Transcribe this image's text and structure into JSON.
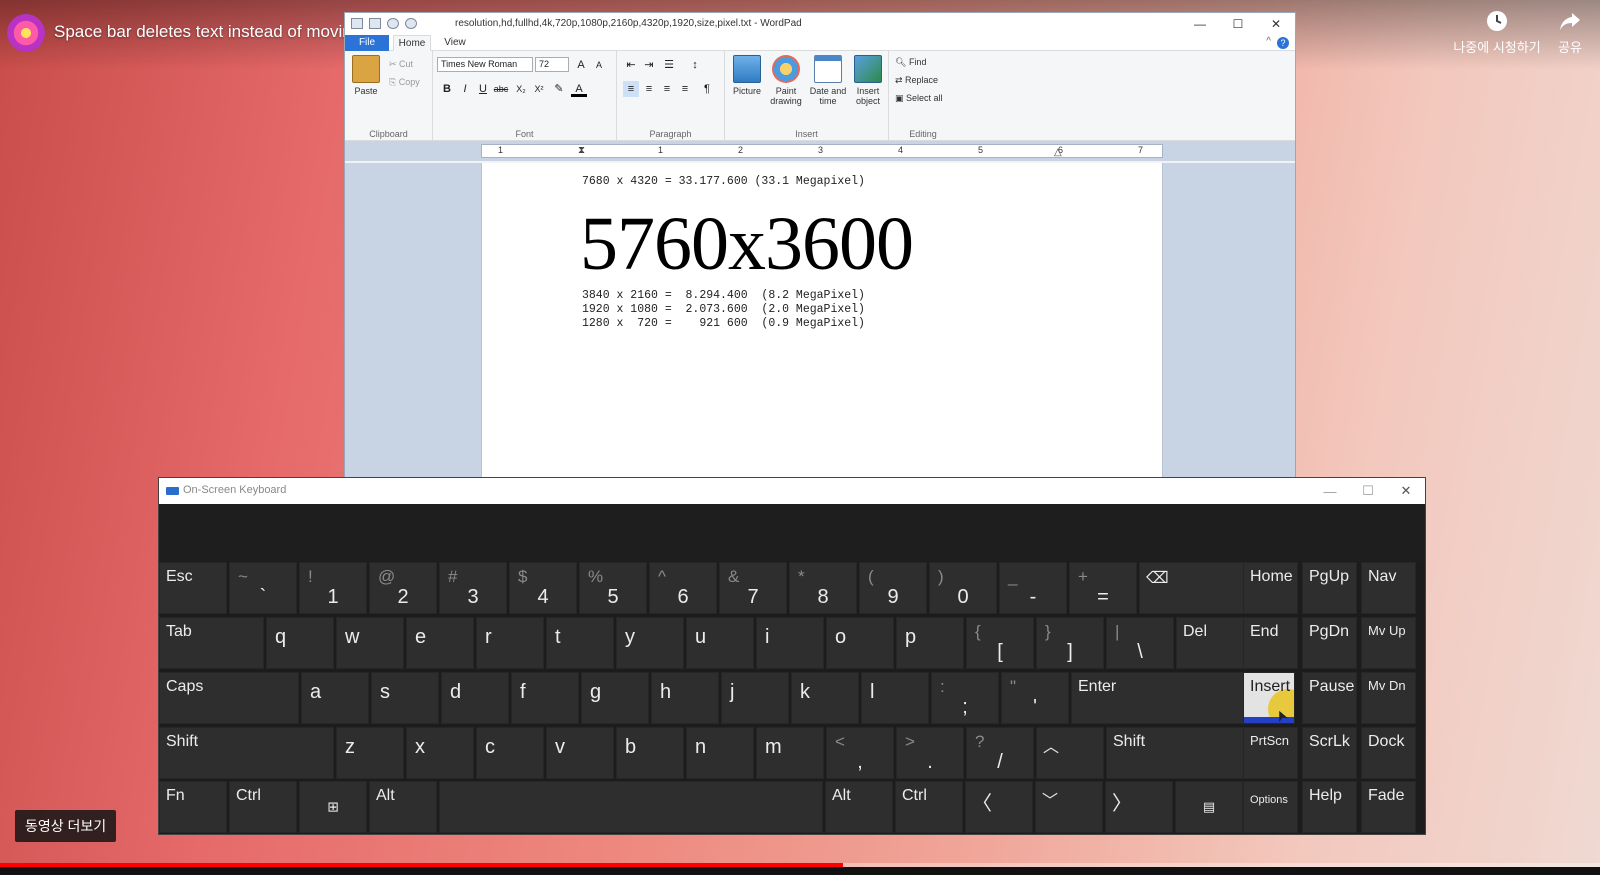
{
  "youtube": {
    "video_title": "Space bar deletes text instead of moving it - Solution",
    "watch_later": "나중에 시청하기",
    "share": "공유",
    "more_videos": "동영상 더보기",
    "progress": 0.527
  },
  "wordpad": {
    "title": "resolution,hd,fullhd,4k,720p,1080p,2160p,4320p,1920,size,pixel.txt - WordPad",
    "tabs": {
      "file": "File",
      "home": "Home",
      "view": "View"
    },
    "clipboard": {
      "paste": "Paste",
      "cut": "Cut",
      "copy": "Copy",
      "label": "Clipboard"
    },
    "font": {
      "name": "Times New Roman",
      "size": "72",
      "label": "Font",
      "bold": "B",
      "italic": "I",
      "underline": "U",
      "strike": "abc",
      "sub": "X₂",
      "sup": "X²"
    },
    "paragraph": {
      "label": "Paragraph"
    },
    "insert": {
      "picture": "Picture",
      "paint_drawing": "Paint drawing",
      "date_time": "Date and time",
      "insert_object": "Insert object",
      "label": "Insert"
    },
    "editing": {
      "find": "Find",
      "replace": "Replace",
      "select_all": "Select all",
      "label": "Editing"
    },
    "ruler_numbers": [
      "1",
      "1",
      "2",
      "3",
      "4",
      "5",
      "6",
      "7"
    ],
    "doc": {
      "line_top": "7680 x 4320 = 33.177.600 (33.1 Megapixel)",
      "big": "5760x3600",
      "lines": [
        "3840 x 2160 =  8.294.400  (8.2 MegaPixel)",
        "1920 x 1080 =  2.073.600  (2.0 MegaPixel)",
        "1280 x  720 =    921 600  (0.9 MegaPixel)"
      ]
    }
  },
  "osk": {
    "title": "On-Screen Keyboard",
    "keys": {
      "esc": "Esc",
      "tab": "Tab",
      "caps": "Caps",
      "shift_l": "Shift",
      "shift_r": "Shift",
      "fn": "Fn",
      "ctrl_l": "Ctrl",
      "alt_l": "Alt",
      "alt_r": "Alt",
      "ctrl_r": "Ctrl",
      "del": "Del",
      "enter": "Enter",
      "home": "Home",
      "pgup": "PgUp",
      "nav": "Nav",
      "end": "End",
      "pgdn": "PgDn",
      "mvup": "Mv Up",
      "insert": "Insert",
      "pause": "Pause",
      "mvdn": "Mv Dn",
      "prtscn": "PrtScn",
      "scrlk": "ScrLk",
      "dock": "Dock",
      "options": "Options",
      "help": "Help",
      "fade": "Fade"
    },
    "number_row": [
      {
        "s": "~",
        "m": "`"
      },
      {
        "s": "!",
        "m": "1"
      },
      {
        "s": "@",
        "m": "2"
      },
      {
        "s": "#",
        "m": "3"
      },
      {
        "s": "$",
        "m": "4"
      },
      {
        "s": "%",
        "m": "5"
      },
      {
        "s": "^",
        "m": "6"
      },
      {
        "s": "&",
        "m": "7"
      },
      {
        "s": "*",
        "m": "8"
      },
      {
        "s": "(",
        "m": "9"
      },
      {
        "s": ")",
        "m": "0"
      },
      {
        "s": "_",
        "m": "-"
      },
      {
        "s": "+",
        "m": "="
      }
    ],
    "row_q": [
      "q",
      "w",
      "e",
      "r",
      "t",
      "y",
      "u",
      "i",
      "o",
      "p"
    ],
    "row_q_sym": [
      {
        "s": "{",
        "m": "["
      },
      {
        "s": "}",
        "m": "]"
      },
      {
        "s": "|",
        "m": "\\"
      }
    ],
    "row_a": [
      "a",
      "s",
      "d",
      "f",
      "g",
      "h",
      "j",
      "k",
      "l"
    ],
    "row_a_sym": [
      {
        "s": ":",
        "m": ";"
      },
      {
        "s": "\"",
        "m": "'"
      }
    ],
    "row_z": [
      "z",
      "x",
      "c",
      "v",
      "b",
      "n",
      "m"
    ],
    "row_z_sym": [
      {
        "s": "<",
        "m": ","
      },
      {
        "s": ">",
        "m": "."
      },
      {
        "s": "?",
        "m": "/"
      }
    ]
  }
}
